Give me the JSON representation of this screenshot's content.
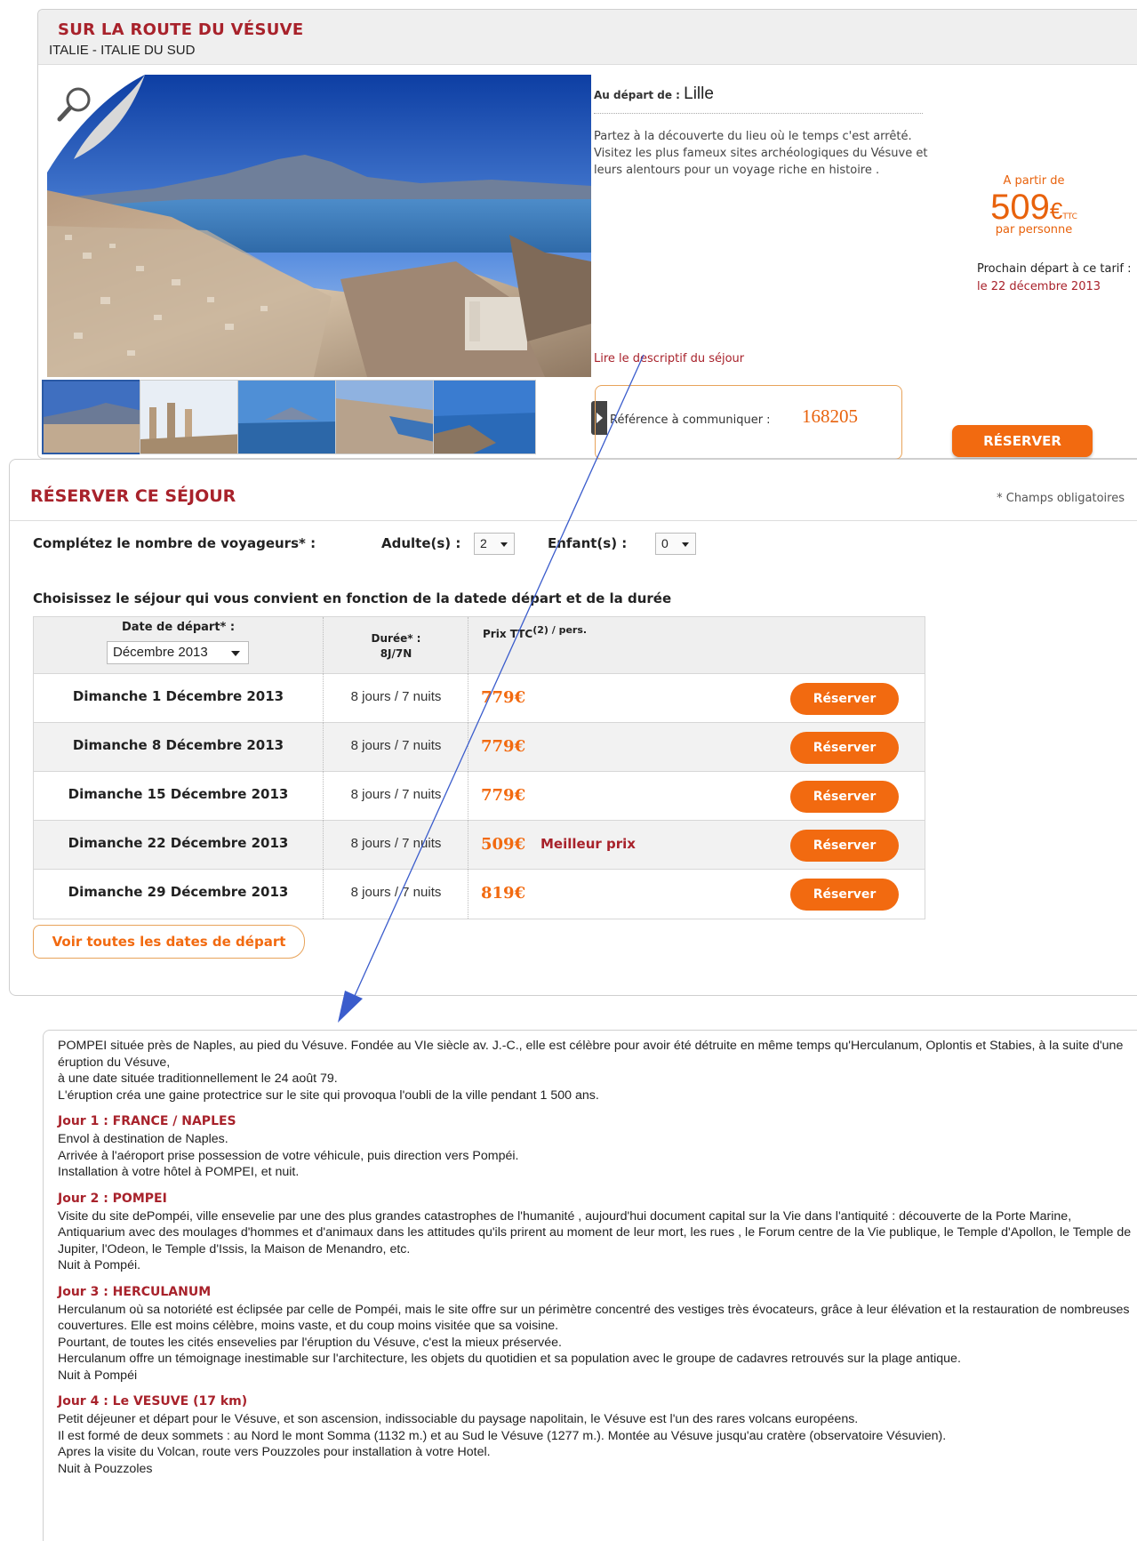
{
  "product": {
    "title": "SUR LA ROUTE DU VÉSUVE",
    "region": "ITALIE - ITALIE DU SUD",
    "depart_label": "Au départ de : ",
    "depart_city": "Lille",
    "description": "Partez à la découverte du lieu où le temps c'est arrêté. Visitez les plus fameux sites archéologiques du Vésuve et leurs alentours pour un voyage riche en histoire .",
    "price_from": "A partir de",
    "price": "509",
    "price_currency": "€",
    "price_ttc": "TTC",
    "price_per": "par personne",
    "next_departure_label": "Prochain départ à ce tarif :",
    "next_departure_date": "le 22 décembre  2013",
    "read_description": "Lire le descriptif du séjour",
    "reference_label": "Référence à communiquer : ",
    "reference_number": "168205",
    "reserve_button": "RÉSERVER"
  },
  "booking": {
    "title": "RÉSERVER CE SÉJOUR",
    "required_note": "* Champs obligatoires",
    "travellers_label": "Complétez le nombre de voyageurs* :",
    "adults_label": "Adulte(s) :",
    "adults_value": "2",
    "children_label": "Enfant(s) :",
    "children_value": "0",
    "choose_label": "Choisissez le séjour qui vous convient en fonction de la datede départ et de la durée",
    "col_date": "Date de départ* :",
    "month_value": "Décembre 2013",
    "col_duration": "Durée* :",
    "col_duration_sub": "8J/7N",
    "col_price": "Prix TTC",
    "col_price_sup": "(2) / pers.",
    "rows": [
      {
        "date": "Dimanche 1 Décembre 2013",
        "duration": "8 jours / 7 nuits",
        "price": "779€",
        "tag": "",
        "button": "Réserver"
      },
      {
        "date": "Dimanche 8 Décembre 2013",
        "duration": "8 jours / 7 nuits",
        "price": "779€",
        "tag": "",
        "button": "Réserver"
      },
      {
        "date": "Dimanche 15 Décembre 2013",
        "duration": "8 jours / 7 nuits",
        "price": "779€",
        "tag": "",
        "button": "Réserver"
      },
      {
        "date": "Dimanche 22 Décembre 2013",
        "duration": "8 jours / 7 nuits",
        "price": "509€",
        "tag": "Meilleur prix",
        "button": "Réserver"
      },
      {
        "date": "Dimanche 29 Décembre 2013",
        "duration": "8 jours / 7 nuits",
        "price": "819€",
        "tag": "",
        "button": "Réserver"
      }
    ],
    "all_dates_button": "Voir toutes les dates de départ"
  },
  "itinerary": {
    "intro": [
      "POMPEI située près de Naples, au pied du Vésuve. Fondée au VIe siècle av. J.-C., elle est célèbre pour avoir été détruite en même temps qu'Herculanum, Oplontis et Stabies, à la suite d'une éruption du Vésuve,",
      "à une date située traditionnellement le 24 août 79.",
      "L'éruption créa une gaine protectrice sur le site qui provoqua l'oubli de la ville pendant 1 500 ans."
    ],
    "days": [
      {
        "title": "Jour 1 : FRANCE / NAPLES",
        "lines": [
          "Envol à destination de Naples.",
          "Arrivée à l'aéroport prise possession de votre véhicule, puis direction vers Pompéi.",
          "Installation à votre hôtel à POMPEI, et nuit."
        ]
      },
      {
        "title": "Jour 2 : POMPEI",
        "lines": [
          "Visite du site dePompéi, ville ensevelie par une des plus grandes catastrophes de l'humanité , aujourd'hui document capital sur la Vie dans l'antiquité : découverte de la Porte Marine, Antiquarium avec des moulages d'hommes et d'animaux dans les attitudes qu'ils prirent au moment de leur mort, les rues , le Forum centre de la Vie publique, le Temple d'Apollon, le Temple de Jupiter, l'Odeon, le Temple d'Issis, la Maison de Menandro, etc.",
          "Nuit à Pompéi."
        ]
      },
      {
        "title": "Jour 3 : HERCULANUM",
        "lines": [
          "Herculanum où sa notoriété est éclipsée par celle de Pompéi, mais le site offre sur un périmètre concentré des vestiges très évocateurs, grâce à leur élévation et la restauration de nombreuses couvertures. Elle est moins célèbre, moins vaste, et du coup moins visitée que sa voisine.",
          "Pourtant, de toutes les cités ensevelies par l'éruption du Vésuve, c'est la mieux préservée.",
          "Herculanum offre un témoignage inestimable sur l'architecture, les objets du quotidien et sa population avec le groupe de cadavres retrouvés sur la plage antique.",
          "Nuit à Pompéi"
        ]
      },
      {
        "title": "Jour 4 : Le VESUVE (17 km)",
        "lines": [
          "Petit déjeuner et départ pour le Vésuve, et son ascension, indissociable du paysage napolitain, le Vésuve est l'un des rares volcans européens.",
          "Il est formé de deux sommets : au Nord le mont Somma (1132 m.) et au Sud le Vésuve (1277 m.). Montée au Vésuve jusqu'au cratère (observatoire Vésuvien).",
          "Apres la visite du Volcan, route vers Pouzzoles pour installation à votre Hotel.",
          "Nuit à Pouzzoles"
        ]
      }
    ]
  },
  "colors": {
    "accent": "#f26a10",
    "title_red": "#a8222b",
    "arrow": "#3a5ccc"
  },
  "icons": [
    "magnifier-icon",
    "chevron-right-icon",
    "chevron-down-icon",
    "arrow-annotation"
  ]
}
